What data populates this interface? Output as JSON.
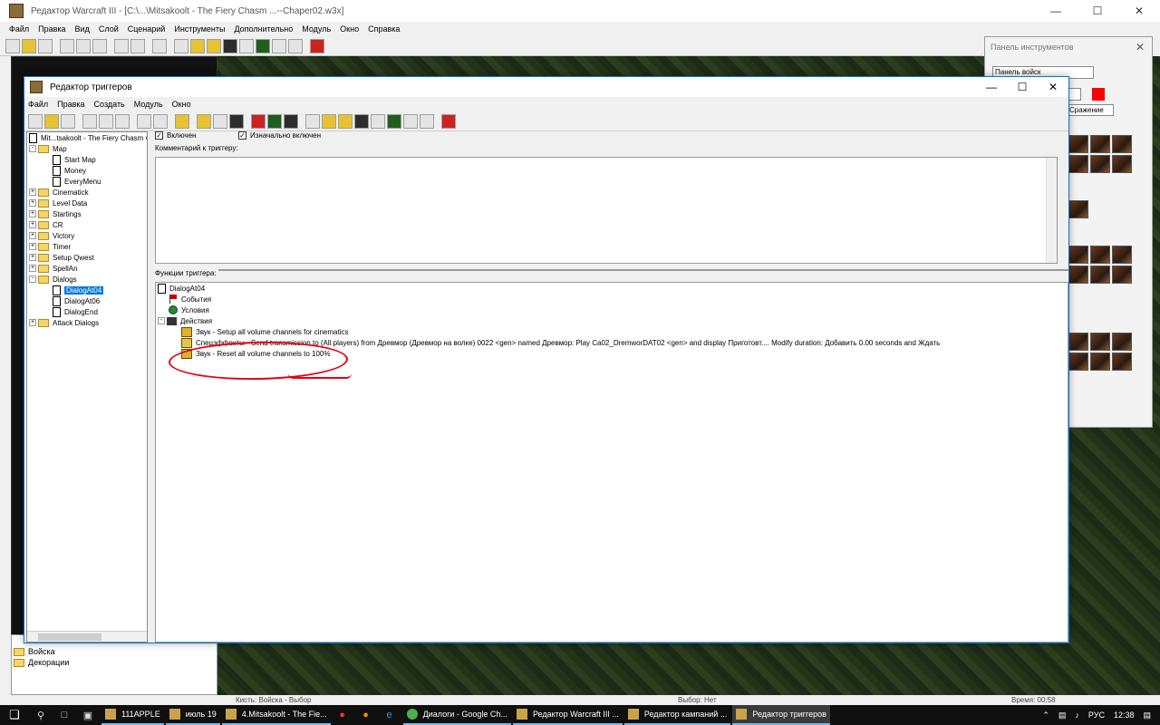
{
  "main_window": {
    "title": "Редактор Warcraft III - [C:\\...\\Mitsakoolt - The Fiery Chasm ...--Chaper02.w3x]",
    "menu": [
      "Файл",
      "Правка",
      "Вид",
      "Слой",
      "Сценарий",
      "Инструменты",
      "Дополнительно",
      "Модуль",
      "Окно",
      "Справка"
    ]
  },
  "tool_panel": {
    "title": "Панель инструментов",
    "dropdown": "Панель войск",
    "dropdown2": "Сражение"
  },
  "left_panel": {
    "items": [
      "Войска",
      "Декорации"
    ]
  },
  "statusbar": {
    "brush": "Кисть: Войска - Выбор",
    "selection": "Выбор: Нет",
    "time": "Время: 00:58"
  },
  "trigger_editor": {
    "title": "Редактор триггеров",
    "menu": [
      "Файл",
      "Правка",
      "Создать",
      "Модуль",
      "Окно"
    ],
    "tree": {
      "root": "Mit...tsakoolt - The Fiery Chasm v",
      "items": [
        {
          "label": "Map",
          "type": "folder",
          "open": true
        },
        {
          "label": "Start Map",
          "type": "trigger"
        },
        {
          "label": "Money",
          "type": "trigger"
        },
        {
          "label": "EveryMenu",
          "type": "trigger"
        },
        {
          "label": "Cinematick",
          "type": "folder"
        },
        {
          "label": "Level Data",
          "type": "folder"
        },
        {
          "label": "Startings",
          "type": "folder"
        },
        {
          "label": "CR",
          "type": "folder"
        },
        {
          "label": "Victory",
          "type": "folder"
        },
        {
          "label": "Timer",
          "type": "folder"
        },
        {
          "label": "Setup Qwest",
          "type": "folder"
        },
        {
          "label": "SpellAn",
          "type": "folder"
        },
        {
          "label": "Dialogs",
          "type": "folder",
          "open": true
        },
        {
          "label": "DialogAt04",
          "type": "trigger",
          "selected": true
        },
        {
          "label": "DialogAt06",
          "type": "trigger"
        },
        {
          "label": "DialogEnd",
          "type": "trigger"
        },
        {
          "label": "Attack Dialogs",
          "type": "folder"
        }
      ]
    },
    "enabled_label": "Включен",
    "initially_on_label": "Изначально включен",
    "comment_label": "Комментарий к триггеру:",
    "functions_label": "Функции триггера:",
    "functions": {
      "trigger_name": "DialogAt04",
      "events": "События",
      "conditions": "Условия",
      "actions": "Действия",
      "action_list": [
        "Звук - Setup all volume channels for cinematics",
        "Спецэффекты - Send transmission to (All players) from Древмор (Древмор на волке) 0022 <gen> named Древмор: Play Ca02_DremworDAT02 <gen> and display Приготовт....  Modify duration: Добавить 0.00 seconds and Ждать",
        "Звук - Reset all volume channels to 100%"
      ]
    }
  },
  "taskbar": {
    "tasks": [
      "111APPLE",
      "июль 19",
      "4.Mitsakoolt - The Fie...",
      "Диалоги - Google Ch...",
      "Редактор Warcraft III ...",
      "Редактор кампаний ...",
      "Редактор триггеров"
    ],
    "lang": "РУС",
    "clock": "12:38"
  }
}
